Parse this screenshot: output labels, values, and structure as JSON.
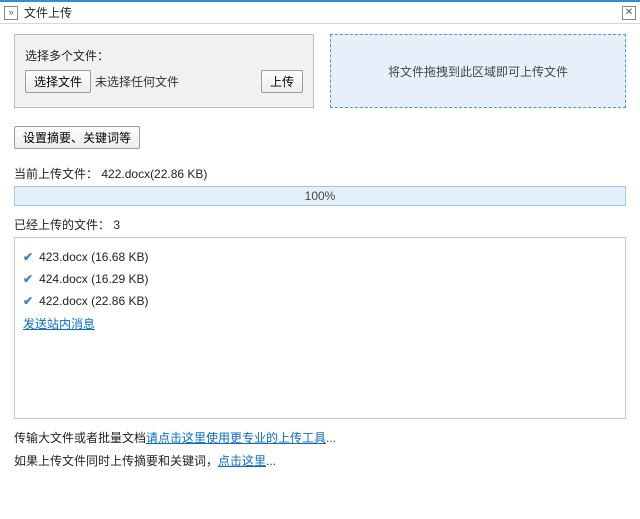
{
  "titlebar": {
    "title": "文件上传",
    "expand_symbol": "»",
    "close_symbol": "✕"
  },
  "upload_box": {
    "label": "选择多个文件：",
    "choose_button": "选择文件",
    "status_text": "未选择任何文件",
    "upload_button": "上传"
  },
  "dropzone": {
    "text": "将文件拖拽到此区域即可上传文件"
  },
  "metadata_button": "设置摘要、关键词等",
  "current": {
    "prefix": "当前上传文件：",
    "filename": "422.docx(22.86 KB)"
  },
  "progress": {
    "text": "100%"
  },
  "uploaded": {
    "prefix": "已经上传的文件：",
    "count": "3",
    "files": [
      {
        "name": "423.docx (16.68 KB)"
      },
      {
        "name": "424.docx (16.29 KB)"
      },
      {
        "name": "422.docx (22.86 KB)"
      }
    ],
    "send_message_link": "发送站内消息"
  },
  "footer": {
    "line1_pre": "传输大文件或者批量文档",
    "line1_link": "请点击这里使用更专业的上传工具",
    "line2_pre": "如果上传文件同时上传摘要和关键词，",
    "line2_link": "点击这里",
    "dots": "..."
  }
}
